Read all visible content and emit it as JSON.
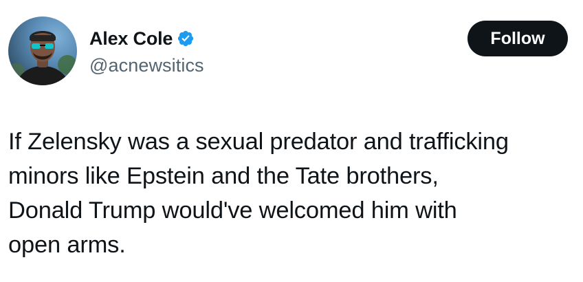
{
  "author": {
    "display_name": "Alex Cole",
    "handle": "@acnewsitics",
    "verified": true,
    "avatar_icon": "user-avatar-photo",
    "verified_icon": "verified-badge-icon",
    "verified_color": "#1d9bf0"
  },
  "actions": {
    "follow_label": "Follow"
  },
  "post": {
    "text": "If Zelensky was a sexual predator and trafficking\nminors like Epstein and the Tate brothers,\nDonald Trump would've welcomed him with\nopen arms."
  },
  "colors": {
    "text_primary": "#0f1419",
    "text_secondary": "#536471",
    "button_background": "#0f1419",
    "button_text": "#ffffff",
    "background": "#ffffff"
  }
}
